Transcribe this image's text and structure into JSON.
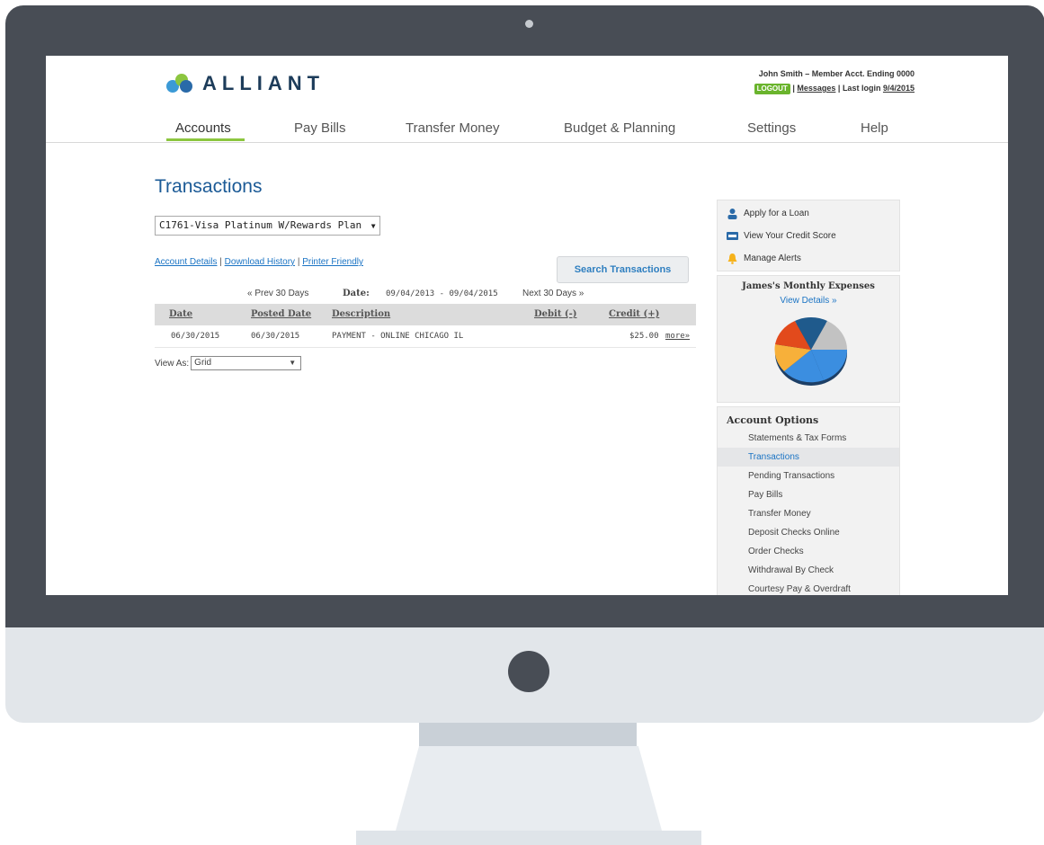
{
  "brand": {
    "name": "ALLIANT"
  },
  "user": {
    "greeting": "John Smith – Member Acct. Ending 0000",
    "logout_label": "LOGOUT",
    "messages_label": "Messages",
    "last_login_label": "Last login",
    "last_login_date": "9/4/2015"
  },
  "nav": {
    "items": [
      {
        "label": "Accounts",
        "active": true
      },
      {
        "label": "Pay Bills"
      },
      {
        "label": "Transfer Money"
      },
      {
        "label": "Budget & Planning"
      },
      {
        "label": "Settings"
      },
      {
        "label": "Help"
      }
    ],
    "active_color": "#8cc63f"
  },
  "main": {
    "title": "Transactions",
    "account_select": "C1761-Visa Platinum W/Rewards Plan",
    "links": [
      "Account Details",
      "Download History",
      "Printer Friendly"
    ],
    "search_button": "Search Transactions",
    "pager": {
      "prev": "« Prev 30 Days",
      "date_label": "Date:",
      "date_range": "09/04/2013 - 09/04/2015",
      "next": "Next 30 Days »"
    },
    "table": {
      "columns": [
        "Date",
        "Posted Date",
        "Description",
        "Debit (-)",
        "Credit (+)"
      ],
      "rows": [
        {
          "date": "06/30/2015",
          "posted": "06/30/2015",
          "description": "PAYMENT - ONLINE CHICAGO IL",
          "debit": "",
          "credit": "$25.00",
          "more": "more»"
        }
      ]
    },
    "view_as_label": "View As:",
    "view_as_value": "Grid"
  },
  "sidebar": {
    "quick_links": [
      {
        "label": "Apply for a Loan",
        "icon": "person-icon"
      },
      {
        "label": "View Your Credit Score",
        "icon": "credit-score-icon"
      },
      {
        "label": "Manage Alerts",
        "icon": "bell-icon"
      }
    ],
    "expenses": {
      "title": "James's Monthly Expenses",
      "link": "View Details »"
    },
    "options": {
      "title": "Account Options",
      "items": [
        "Statements & Tax Forms",
        "Transactions",
        "Pending Transactions",
        "Pay Bills",
        "Transfer Money",
        "Deposit Checks Online",
        "Order Checks",
        "Withdrawal By Check",
        "Courtesy Pay & Overdraft"
      ],
      "active_index": 1
    }
  },
  "colors": {
    "brand_blue": "#1b5a96",
    "link_blue": "#1b74c4",
    "logout_green": "#6ab42d",
    "monitor_bezel": "#484d55"
  }
}
